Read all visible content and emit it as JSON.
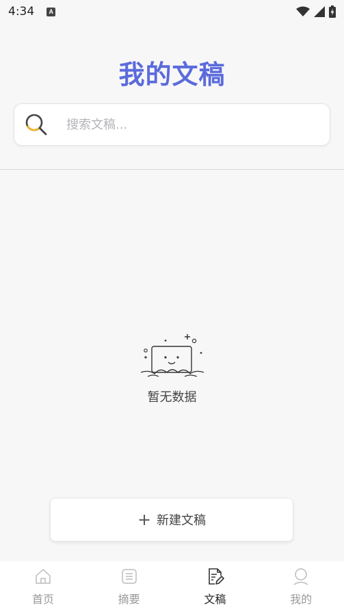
{
  "status_bar": {
    "time": "4:34",
    "a_glyph": "A"
  },
  "header": {
    "title": "我的文稿"
  },
  "search": {
    "placeholder": "搜索文稿..."
  },
  "empty_state": {
    "text": "暂无数据"
  },
  "new_button": {
    "label": "新建文稿",
    "plus": "+"
  },
  "bottom_nav": {
    "items": [
      {
        "label": "首页",
        "icon": "home-icon",
        "active": false
      },
      {
        "label": "摘要",
        "icon": "summary-icon",
        "active": false
      },
      {
        "label": "文稿",
        "icon": "document-edit-icon",
        "active": true
      },
      {
        "label": "我的",
        "icon": "profile-icon",
        "active": false
      }
    ]
  },
  "colors": {
    "accent": "#5b6bdb",
    "search_accent": "#f0b429",
    "inactive": "#999999"
  }
}
